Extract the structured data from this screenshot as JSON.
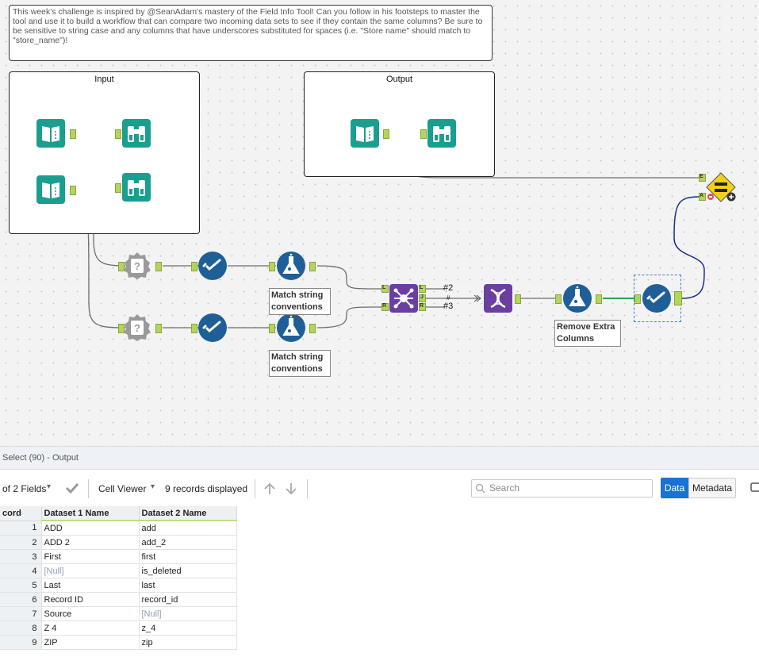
{
  "canvas": {
    "comment_text": "This week's challenge is inspired by @SeanAdam's mastery of the Field Info Tool! Can you follow in his footsteps to master the tool and use it to build a workflow that can compare two incoming data sets to see if they contain the same columns? Be sure to be sensitive to string case and any columns that have underscores substituted for spaces (i.e. \"Store name\" should match to \"store_name\")!",
    "container_input_title": "Input",
    "container_output_title": "Output",
    "annotation_match_1": "Match string conventions",
    "annotation_match_2": "Match string conventions",
    "annotation_remove": "Remove Extra Columns",
    "conn_label_2": "#2",
    "conn_label_hash": "#",
    "conn_label_3": "#3",
    "anchor_L": "L",
    "anchor_J": "J",
    "anchor_R": "R",
    "anchor_E": "E",
    "anchor_A": "A",
    "colors": {
      "tool_teal": "#1a9e8f",
      "tool_blue": "#1f5f97",
      "tool_purple": "#6b3fa0",
      "tool_gray": "#9a9a9a",
      "anchor_green": "#b5d45c",
      "test_yellow": "#f5d018"
    }
  },
  "results": {
    "header_title": "Select (90) - Output",
    "fields_label": "of 2 Fields",
    "cell_viewer_label": "Cell Viewer",
    "records_label": "9 records displayed",
    "search_placeholder": "Search",
    "data_button": "Data",
    "metadata_button": "Metadata",
    "columns": [
      "cord",
      "Dataset 1 Name",
      "Dataset 2 Name"
    ],
    "rows": [
      {
        "rec": "1",
        "d1": "ADD",
        "d2": "add"
      },
      {
        "rec": "2",
        "d1": "ADD 2",
        "d2": "add_2"
      },
      {
        "rec": "3",
        "d1": "First",
        "d2": "first"
      },
      {
        "rec": "4",
        "d1": "[Null]",
        "d2": "is_deleted"
      },
      {
        "rec": "5",
        "d1": "Last",
        "d2": "last"
      },
      {
        "rec": "6",
        "d1": "Record ID",
        "d2": "record_id"
      },
      {
        "rec": "7",
        "d1": "Source",
        "d2": "[Null]"
      },
      {
        "rec": "8",
        "d1": "Z 4",
        "d2": "z_4"
      },
      {
        "rec": "9",
        "d1": "ZIP",
        "d2": "zip"
      }
    ]
  }
}
